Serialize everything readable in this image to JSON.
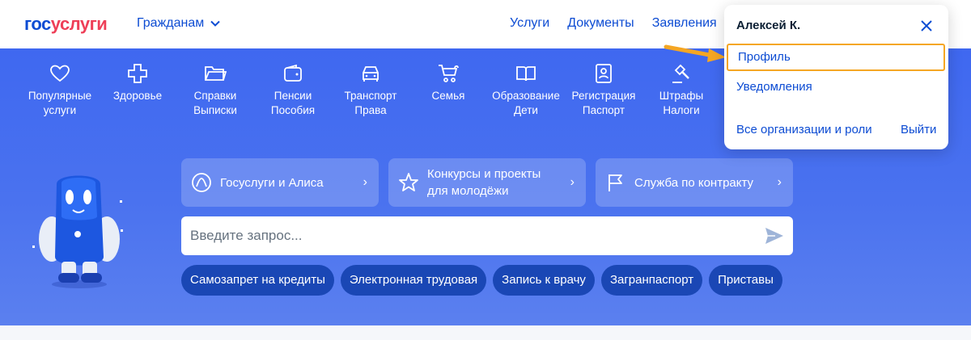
{
  "header": {
    "logo_part1": "гос",
    "logo_part2": "услуги",
    "audience": "Гражданам",
    "nav": [
      "Услуги",
      "Документы",
      "Заявления"
    ]
  },
  "categories": [
    {
      "line1": "Популярные",
      "line2": "услуги",
      "icon": "heart-icon"
    },
    {
      "line1": "Здоровье",
      "line2": "",
      "icon": "health-cross-icon"
    },
    {
      "line1": "Справки",
      "line2": "Выписки",
      "icon": "folder-icon"
    },
    {
      "line1": "Пенсии",
      "line2": "Пособия",
      "icon": "wallet-icon"
    },
    {
      "line1": "Транспорт",
      "line2": "Права",
      "icon": "car-icon"
    },
    {
      "line1": "Семья",
      "line2": "",
      "icon": "stroller-icon"
    },
    {
      "line1": "Образование",
      "line2": "Дети",
      "icon": "book-icon"
    },
    {
      "line1": "Регистрация",
      "line2": "Паспорт",
      "icon": "id-card-icon"
    },
    {
      "line1": "Штрафы",
      "line2": "Налоги",
      "icon": "gavel-icon"
    }
  ],
  "promos": [
    {
      "line1": "Госуслуги и Алиса",
      "line2": "",
      "icon": "alice-icon"
    },
    {
      "line1": "Конкурсы и проекты",
      "line2": "для молодёжи",
      "icon": "star-icon"
    },
    {
      "line1": "Служба по контракту",
      "line2": "",
      "icon": "flag-icon"
    }
  ],
  "search": {
    "placeholder": "Введите запрос..."
  },
  "chips": [
    "Самозапрет на кредиты",
    "Электронная трудовая",
    "Запись к врачу",
    "Загранпаспорт",
    "Приставы"
  ],
  "dropdown": {
    "user": "Алексей К.",
    "profile": "Профиль",
    "notifications": "Уведомления",
    "orgs": "Все организации и роли",
    "logout": "Выйти"
  },
  "colors": {
    "brand_blue": "#0d4cd3",
    "brand_red": "#ee3f58",
    "hero_blue": "#4a72ef",
    "chip_blue": "#1a47b5",
    "highlight": "#f5a623"
  }
}
